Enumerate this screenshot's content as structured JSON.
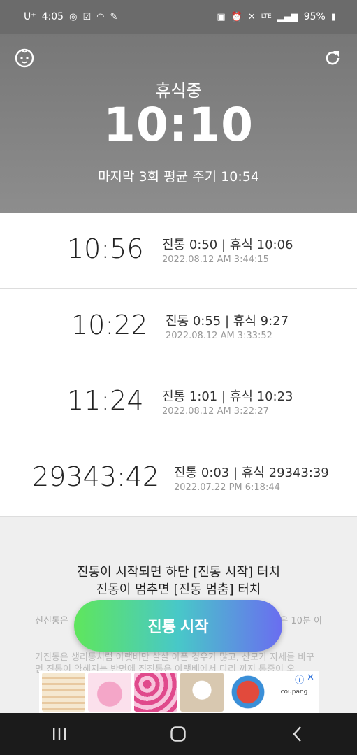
{
  "status_bar": {
    "carrier": "U⁺",
    "time": "4:05",
    "network": "LTE",
    "battery": "95%"
  },
  "header": {
    "state": "휴식중",
    "timer": "10:10",
    "average": "마지막 3회 평균 주기 10:54"
  },
  "records": [
    {
      "total": "10:56",
      "detail": "진통 0:50 | 휴식 10:06",
      "datetime": "2022.08.12 AM 3:44:15"
    },
    {
      "total": "10:22",
      "detail": "진통 0:55 | 휴식 9:27",
      "datetime": "2022.08.12 AM 3:33:52"
    },
    {
      "total": "11:24",
      "detail": "진통 1:01 | 휴식 10:23",
      "datetime": "2022.08.12 AM 3:22:27"
    },
    {
      "total": "29343:42",
      "detail": "진통 0:03 | 휴식 29343:39",
      "datetime": "2022.07.22 PM 6:18:44"
    }
  ],
  "info": {
    "line1": "진통이 시작되면 하단 [진통 시작] 터치",
    "line2": "진동이 멈추면 [진동 멈춤] 터치",
    "faded1_left": "신신통은",
    "faded1_right": "은 10분 이",
    "faded2": "가진동은 생리통처럼 아랫배만 살살 아픈 경우가 많고, 산모가 자세를 바꾸면 진통이 약해지는 반면에 진진통은 아랫배에서 다리 까지 통증이 오"
  },
  "start_button": "진통 시작",
  "ad": {
    "brand": "coupang"
  },
  "colors": {
    "header_bg": "#808080",
    "button_start": "#5fe65c",
    "button_end": "#6a6df0"
  }
}
